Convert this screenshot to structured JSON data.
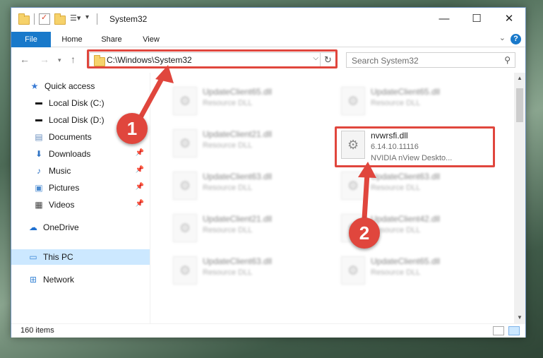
{
  "window": {
    "title": "System32"
  },
  "window_controls": {
    "minimize": "—",
    "maximize": "☐",
    "close": "✕"
  },
  "ribbon": {
    "file": "File",
    "home": "Home",
    "share": "Share",
    "view": "View",
    "help": "?"
  },
  "address": {
    "path": "C:\\Windows\\System32",
    "refresh": "↻",
    "dropdown": "⌵"
  },
  "search": {
    "placeholder": "Search System32",
    "icon": "⚲"
  },
  "sidebar": {
    "items": [
      {
        "label": "Quick access",
        "icon": "star-icon"
      },
      {
        "label": "Local Disk (C:)",
        "icon": "drive-icon"
      },
      {
        "label": "Local Disk (D:)",
        "icon": "drive-icon"
      },
      {
        "label": "Documents",
        "icon": "documents-icon"
      },
      {
        "label": "Downloads",
        "icon": "downloads-icon"
      },
      {
        "label": "Music",
        "icon": "music-icon"
      },
      {
        "label": "Pictures",
        "icon": "pictures-icon"
      },
      {
        "label": "Videos",
        "icon": "videos-icon"
      },
      {
        "label": "OneDrive",
        "icon": "cloud-icon"
      },
      {
        "label": "This PC",
        "icon": "computer-icon"
      },
      {
        "label": "Network",
        "icon": "network-icon"
      }
    ]
  },
  "files": {
    "col1": [
      {
        "name": "UpdateClient65.dll",
        "type": "Resource DLL"
      },
      {
        "name": "UpdateClient21.dll",
        "type": "Resource DLL"
      },
      {
        "name": "UpdateClient63.dll",
        "type": "Resource DLL"
      },
      {
        "name": "UpdateClient21.dll",
        "type": "Resource DLL"
      },
      {
        "name": "UpdateClient63.dll",
        "type": "Resource DLL"
      }
    ],
    "col2": [
      {
        "name": "UpdateClient65.dll",
        "type": "Resource DLL"
      },
      {
        "name": "UpdateClient63.dll",
        "type": "Resource DLL"
      },
      {
        "name": "UpdateClient42.dll",
        "type": "Resource DLL"
      },
      {
        "name": "UpdateClient65.dll",
        "type": "Resource DLL"
      }
    ],
    "highlighted": {
      "name": "nvwrsfi.dll",
      "version": "6.14.10.11116",
      "description": "NVIDIA nView Deskto..."
    }
  },
  "status": {
    "count": "160 items"
  },
  "annotations": {
    "badge1": "1",
    "badge2": "2"
  },
  "colors": {
    "accent": "#1979ca",
    "highlight": "#e0463d",
    "selected": "#cce8ff"
  }
}
